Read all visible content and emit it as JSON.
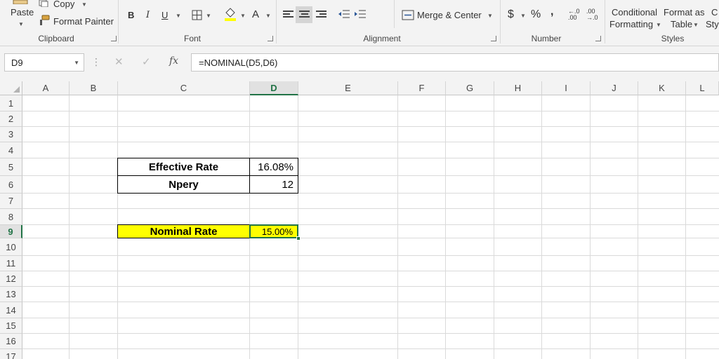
{
  "ribbon": {
    "clipboard": {
      "paste": "Paste",
      "copy": "Copy",
      "format_painter": "Format Painter",
      "label": "Clipboard"
    },
    "font": {
      "bold": "B",
      "italic": "I",
      "underline": "U",
      "font_color": "A",
      "label": "Font"
    },
    "alignment": {
      "merge_center": "Merge & Center",
      "label": "Alignment"
    },
    "number": {
      "currency": "$",
      "percent": "%",
      "comma": ",",
      "increase_decimal": "←.0 .00",
      "decrease_decimal": ".00 →.0",
      "label": "Number"
    },
    "styles": {
      "conditional_1": "Conditional",
      "conditional_2": "Formatting",
      "format_as_1": "Format as",
      "format_as_2": "Table",
      "cell_styles_1": "C",
      "cell_styles_2": "Sty",
      "label": "Styles"
    }
  },
  "formula_bar": {
    "name_box": "D9",
    "dots": "⋮",
    "cancel": "✕",
    "enter": "✓",
    "fx": "fx",
    "formula": "=NOMINAL(D5,D6)"
  },
  "grid": {
    "columns": [
      "A",
      "B",
      "C",
      "D",
      "E",
      "F",
      "G",
      "H",
      "I",
      "J",
      "K",
      "L"
    ],
    "active_column": "D",
    "rows": [
      "1",
      "2",
      "3",
      "4",
      "5",
      "6",
      "7",
      "8",
      "9",
      "10",
      "11",
      "12",
      "13",
      "14",
      "15",
      "16",
      "17"
    ],
    "active_row": "9",
    "cells": {
      "C5": "Effective Rate",
      "D5": "16.08%",
      "C6": "Npery",
      "D6": "12",
      "C9": "Nominal Rate",
      "D9": "15.00%"
    }
  },
  "colors": {
    "accent": "#217346",
    "highlight": "#ffff00"
  }
}
